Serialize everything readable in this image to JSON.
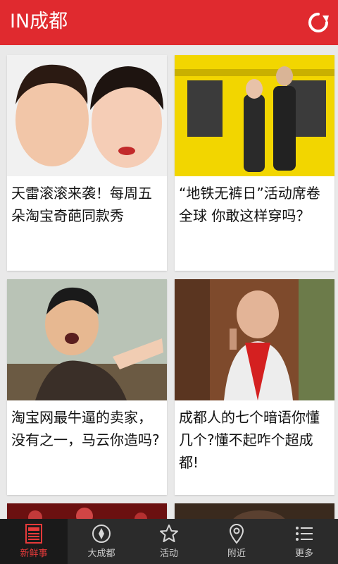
{
  "header": {
    "title": "IN成都"
  },
  "feed": {
    "cards": [
      {
        "caption": "天雷滚滚来袭！每周五朵淘宝奇葩同款秀"
      },
      {
        "caption": "“地铁无裤日”活动席卷全球 你敢这样穿吗？"
      },
      {
        "caption": "淘宝网最牛逼的卖家，没有之一，马云你造吗?"
      },
      {
        "caption": "成都人的七个暗语你懂几个?懂不起咋个超成都!"
      }
    ]
  },
  "tabbar": {
    "tabs": [
      {
        "label": "新鲜事",
        "icon": "news-icon"
      },
      {
        "label": "大成都",
        "icon": "compass-icon"
      },
      {
        "label": "活动",
        "icon": "star-icon"
      },
      {
        "label": "附近",
        "icon": "location-pin-icon"
      },
      {
        "label": "更多",
        "icon": "list-icon"
      }
    ]
  },
  "colors": {
    "brand": "#e02a2f",
    "tabbar": "#2b2b2b",
    "active_tab_text": "#e53a3a"
  }
}
